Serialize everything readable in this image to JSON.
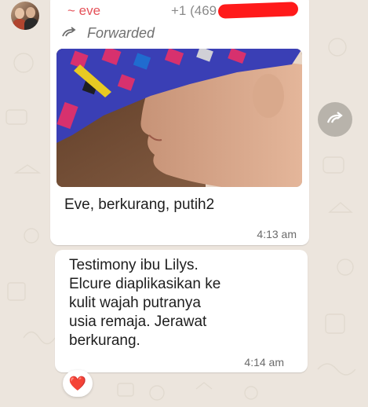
{
  "message1": {
    "sender": "~ eve",
    "phone": "+1 (469",
    "forwarded_label": "Forwarded",
    "forwarded_icon": "forward-arrow-icon",
    "caption": "Eve, berkurang, putih2",
    "time": "4:13 am"
  },
  "message2": {
    "text": "Testimony ibu Lilys.\nElcure diaplikasikan ke\nkulit wajah putranya\nusia remaja. Jerawat\nberkurang.",
    "time": "4:14 am"
  },
  "reaction": {
    "emoji": "❤️"
  },
  "forward_button": {
    "icon": "forward-icon"
  },
  "colors": {
    "sender": "#e5525a",
    "background": "#ece5dd",
    "bubble": "#ffffff",
    "redaction": "#ff1a1a"
  }
}
